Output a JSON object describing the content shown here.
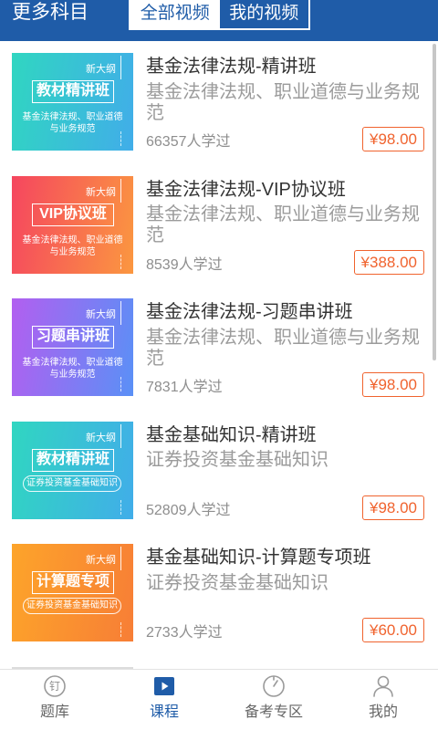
{
  "header": {
    "more_subjects": "更多科目",
    "tabs": [
      {
        "label": "全部视频",
        "selected": true
      },
      {
        "label": "我的视频",
        "selected": false
      }
    ]
  },
  "courses": [
    {
      "thumb": {
        "badge": "新大纲",
        "title": "教材精讲班",
        "desc": [
          "基金法律法规、职业道德",
          "与业务规范"
        ],
        "colors": [
          "#30d6c1",
          "#41ade9"
        ]
      },
      "title": "基金法律法规-精讲班",
      "subtitle": "基金法律法规、职业道德与业务规范",
      "learners": "66357人学过",
      "price": "¥98.00"
    },
    {
      "thumb": {
        "badge": "新大纲",
        "title": "VIP协议班",
        "desc": [
          "基金法律法规、职业道德",
          "与业务规范"
        ],
        "colors": [
          "#f5465f",
          "#fb9740"
        ]
      },
      "title": "基金法律法规-VIP协议班",
      "subtitle": "基金法律法规、职业道德与业务规范",
      "learners": "8539人学过",
      "price": "¥388.00"
    },
    {
      "thumb": {
        "badge": "新大纲",
        "title": "习题串讲班",
        "desc": [
          "基金法律法规、职业道德",
          "与业务规范"
        ],
        "colors": [
          "#b25ff0",
          "#5a90f6"
        ]
      },
      "title": "基金法律法规-习题串讲班",
      "subtitle": "基金法律法规、职业道德与业务规范",
      "learners": "7831人学过",
      "price": "¥98.00"
    },
    {
      "thumb": {
        "badge": "新大纲",
        "title": "教材精讲班",
        "desc": [
          "证券投资基金基础知识"
        ],
        "colors": [
          "#30d6c1",
          "#41ade9"
        ]
      },
      "title": "基金基础知识-精讲班",
      "subtitle": "证券投资基金基础知识",
      "learners": "52809人学过",
      "price": "¥98.00"
    },
    {
      "thumb": {
        "badge": "新大纲",
        "title": "计算题专项",
        "desc": [
          "证券投资基金基础知识"
        ],
        "colors": [
          "#fda42a",
          "#f77e36"
        ]
      },
      "title": "基金基础知识-计算题专项班",
      "subtitle": "证券投资基金基础知识",
      "learners": "2733人学过",
      "price": "¥60.00"
    }
  ],
  "bottom_nav": {
    "items": [
      {
        "label": "题库",
        "icon": "question-bank-icon",
        "glyph": "钉",
        "active": false
      },
      {
        "label": "课程",
        "icon": "play-icon",
        "active": true
      },
      {
        "label": "备考专区",
        "icon": "gauge-icon",
        "active": false
      },
      {
        "label": "我的",
        "icon": "person-icon",
        "active": false
      }
    ]
  },
  "colors": {
    "brand_blue": "#1f5ca8",
    "price_orange": "#f0632e",
    "inactive_icon": "#9a9a9a"
  }
}
